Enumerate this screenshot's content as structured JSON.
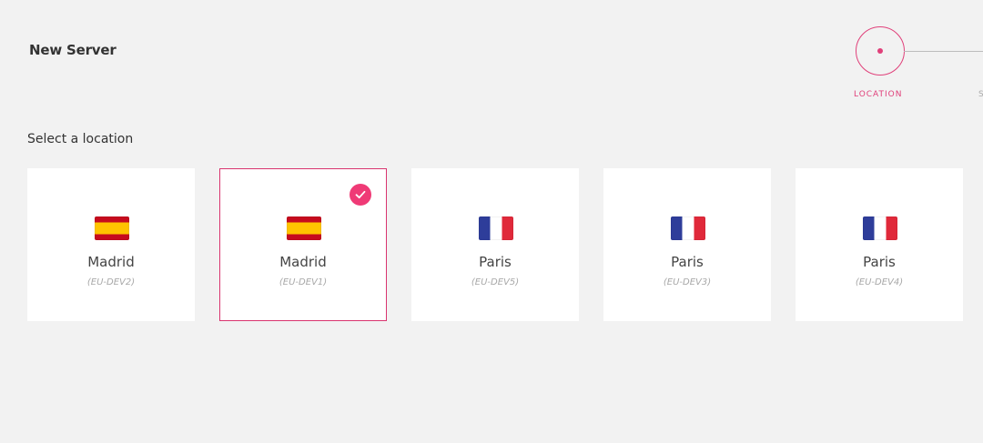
{
  "header": {
    "title": "New Server"
  },
  "stepper": {
    "steps": [
      {
        "label": "LOCATION",
        "state": "active"
      },
      {
        "label": "S",
        "state": "upcoming"
      }
    ],
    "accent_color": "#e0407a"
  },
  "section": {
    "title": "Select a location"
  },
  "locations": [
    {
      "city": "Madrid",
      "code": "(EU-DEV2)",
      "flag": "spain-flag-icon",
      "selected": false
    },
    {
      "city": "Madrid",
      "code": "(EU-DEV1)",
      "flag": "spain-flag-icon",
      "selected": true
    },
    {
      "city": "Paris",
      "code": "(EU-DEV5)",
      "flag": "france-flag-icon",
      "selected": false
    },
    {
      "city": "Paris",
      "code": "(EU-DEV3)",
      "flag": "france-flag-icon",
      "selected": false
    },
    {
      "city": "Paris",
      "code": "(EU-DEV4)",
      "flag": "france-flag-icon",
      "selected": false
    }
  ],
  "colors": {
    "background": "#f2f2f2",
    "card": "#ffffff",
    "selected_border": "#d9346f",
    "check_badge": "#ef3a76"
  },
  "icons": {
    "check": "checkmark-icon"
  }
}
